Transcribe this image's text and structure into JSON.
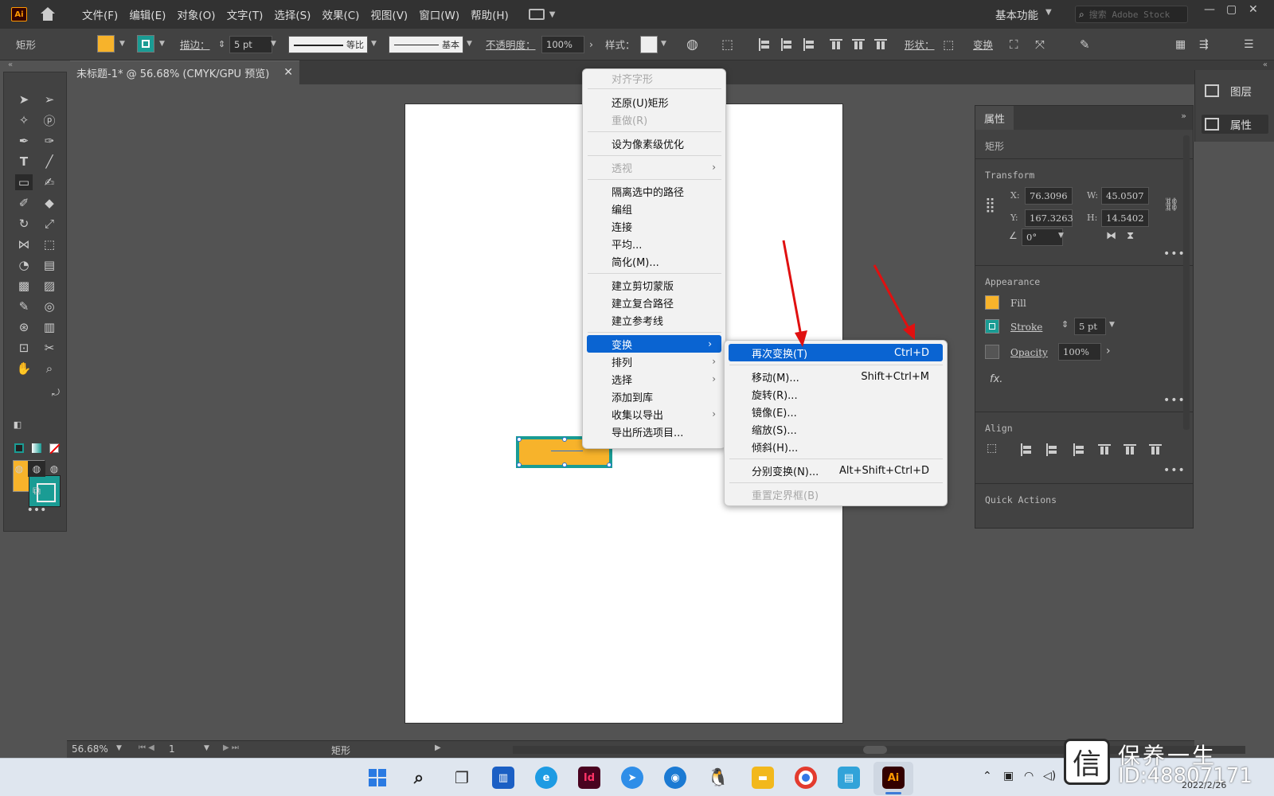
{
  "app": {
    "logo": "Ai",
    "workspace": "基本功能",
    "search_placeholder": "搜索 Adobe Stock"
  },
  "menubar": [
    "文件(F)",
    "编辑(E)",
    "对象(O)",
    "文字(T)",
    "选择(S)",
    "效果(C)",
    "视图(V)",
    "窗口(W)",
    "帮助(H)"
  ],
  "control_bar": {
    "selection_type": "矩形",
    "stroke_label": "描边：",
    "stroke_weight": "5 pt",
    "profile_label": "等比",
    "brush_label": "基本",
    "opacity_label": "不透明度：",
    "opacity_value": "100%",
    "style_label": "样式：",
    "shape_label": "形状：",
    "transform_label": "变换",
    "fill_color": "#F7B32B",
    "stroke_color": "#1A9C94"
  },
  "document_tab": {
    "title": "未标题-1* @ 56.68% (CMYK/GPU 预览)"
  },
  "context_menu": {
    "items": [
      {
        "label": "对齐字形",
        "disabled": true
      },
      {
        "label": "还原(U)矩形"
      },
      {
        "label": "重做(R)",
        "disabled": true
      },
      {
        "label": "设为像素级优化"
      },
      {
        "label": "透视",
        "disabled": true,
        "submenu": true
      },
      {
        "label": "隔离选中的路径"
      },
      {
        "label": "编组"
      },
      {
        "label": "连接"
      },
      {
        "label": "平均..."
      },
      {
        "label": "简化(M)..."
      },
      {
        "label": "建立剪切蒙版"
      },
      {
        "label": "建立复合路径"
      },
      {
        "label": "建立参考线"
      },
      {
        "label": "变换",
        "submenu": true,
        "highlighted": true
      },
      {
        "label": "排列",
        "submenu": true
      },
      {
        "label": "选择",
        "submenu": true
      },
      {
        "label": "添加到库"
      },
      {
        "label": "收集以导出",
        "submenu": true
      },
      {
        "label": "导出所选项目..."
      }
    ]
  },
  "transform_submenu": {
    "items": [
      {
        "label": "再次变换(T)",
        "shortcut": "Ctrl+D",
        "highlighted": true
      },
      {
        "label": "移动(M)...",
        "shortcut": "Shift+Ctrl+M"
      },
      {
        "label": "旋转(R)..."
      },
      {
        "label": "镜像(E)..."
      },
      {
        "label": "缩放(S)..."
      },
      {
        "label": "倾斜(H)..."
      },
      {
        "label": "分别变换(N)...",
        "shortcut": "Alt+Shift+Ctrl+D"
      },
      {
        "label": "重置定界框(B)",
        "disabled": true
      }
    ]
  },
  "right_dock": {
    "layers_label": "图层",
    "properties_label": "属性"
  },
  "properties_panel": {
    "tab": "属性",
    "selection_type": "矩形",
    "transform": {
      "title": "Transform",
      "x_label": "X:",
      "x": "76.3096",
      "y_label": "Y:",
      "y": "167.3263",
      "w_label": "W:",
      "w": "45.0507",
      "h_label": "H:",
      "h": "14.5402",
      "angle": "0°"
    },
    "appearance": {
      "title": "Appearance",
      "fill_label": "Fill",
      "stroke_label": "Stroke",
      "stroke_weight": "5 pt",
      "opacity_label": "Opacity",
      "opacity": "100%",
      "fx": "fx."
    },
    "align": {
      "title": "Align"
    },
    "quick_actions": {
      "title": "Quick Actions"
    }
  },
  "status_bar": {
    "zoom": "56.68%",
    "artboard": "1",
    "tool": "矩形"
  },
  "watermark": {
    "line1": "保养一生",
    "line2": "ID:48807171"
  },
  "taskbar": {
    "date": "2022/2/26"
  }
}
